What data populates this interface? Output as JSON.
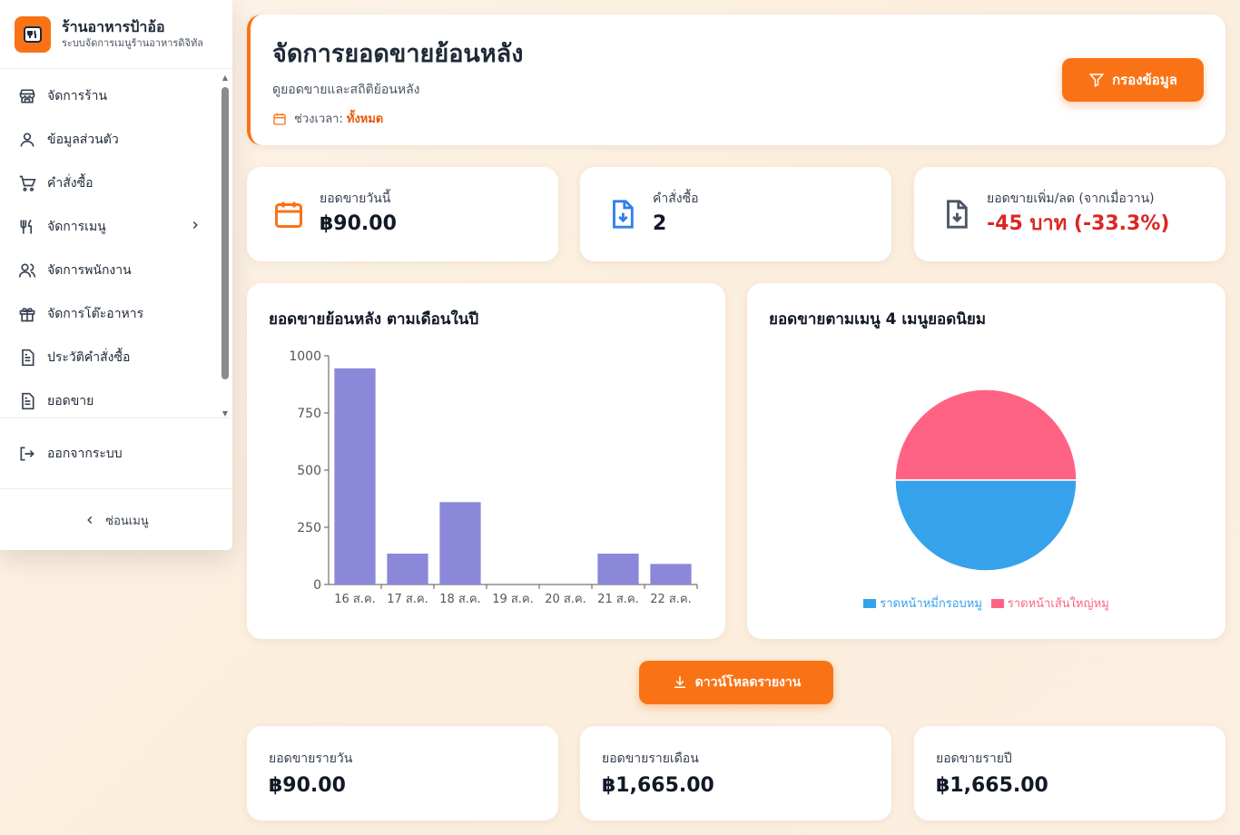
{
  "brand": {
    "title": "ร้านอาหารป้าอ้อ",
    "subtitle": "ระบบจัดการเมนูร้านอาหารดิจิทัล"
  },
  "sidebar": {
    "items": [
      {
        "label": "จัดการร้าน",
        "icon": "store-icon"
      },
      {
        "label": "ข้อมูลส่วนตัว",
        "icon": "user-icon"
      },
      {
        "label": "คำสั่งซื้อ",
        "icon": "cart-icon"
      },
      {
        "label": "จัดการเมนู",
        "icon": "utensils-icon"
      },
      {
        "label": "จัดการพนักงาน",
        "icon": "users-icon"
      },
      {
        "label": "จัดการโต๊ะอาหาร",
        "icon": "gift-icon"
      },
      {
        "label": "ประวัติคำสั่งซื้อ",
        "icon": "document-icon"
      },
      {
        "label": "ยอดขาย",
        "icon": "document-icon"
      }
    ],
    "logout": "ออกจากระบบ",
    "collapse": "ซ่อนเมนู"
  },
  "header": {
    "title": "จัดการยอดขายย้อนหลัง",
    "subtitle": "ดูยอดขายและสถิติย้อนหลัง",
    "period_label": "ช่วงเวลา:",
    "period_value": "ทั้งหมด",
    "filter_button": "กรองข้อมูล"
  },
  "stats": [
    {
      "label": "ยอดขายวันนี้",
      "value": "฿90.00",
      "icon": "calendar-icon"
    },
    {
      "label": "คำสั่งซื้อ",
      "value": "2",
      "icon": "file-download-icon"
    },
    {
      "label": "ยอดขายเพิ่ม/ลด (จากเมื่อวาน)",
      "value": "-45 บาท (-33.3%)",
      "icon": "file-download-icon"
    }
  ],
  "charts": {
    "bar_title": "ยอดขายย้อนหลัง ตามเดือนในปี",
    "pie_title": "ยอดขายตามเมนู 4 เมนูยอดนิยม"
  },
  "chart_data": [
    {
      "type": "bar",
      "categories": [
        "16 ส.ค.",
        "17 ส.ค.",
        "18 ส.ค.",
        "19 ส.ค.",
        "20 ส.ค.",
        "21 ส.ค.",
        "22 ส.ค."
      ],
      "values": [
        945,
        135,
        360,
        0,
        0,
        135,
        90
      ],
      "ylim": [
        0,
        1000
      ],
      "yticks": [
        0,
        250,
        500,
        750,
        1000
      ],
      "color": "#8b87d9",
      "grid": false
    },
    {
      "type": "pie",
      "labels": [
        "ราดหน้าหมี่กรอบหมู",
        "ราดหน้าเส้นใหญ่หมู"
      ],
      "values": [
        50,
        50
      ],
      "colors": [
        "#36a2eb",
        "#ff6384"
      ],
      "legend": "bottom"
    }
  ],
  "download_button": "ดาวน์โหลดรายงาน",
  "summary": [
    {
      "label": "ยอดขายรายวัน",
      "value": "฿90.00"
    },
    {
      "label": "ยอดขายรายเดือน",
      "value": "฿1,665.00"
    },
    {
      "label": "ยอดขายรายปี",
      "value": "฿1,665.00"
    }
  ],
  "colors": {
    "accent": "#f97316",
    "negative": "#dc2626"
  }
}
